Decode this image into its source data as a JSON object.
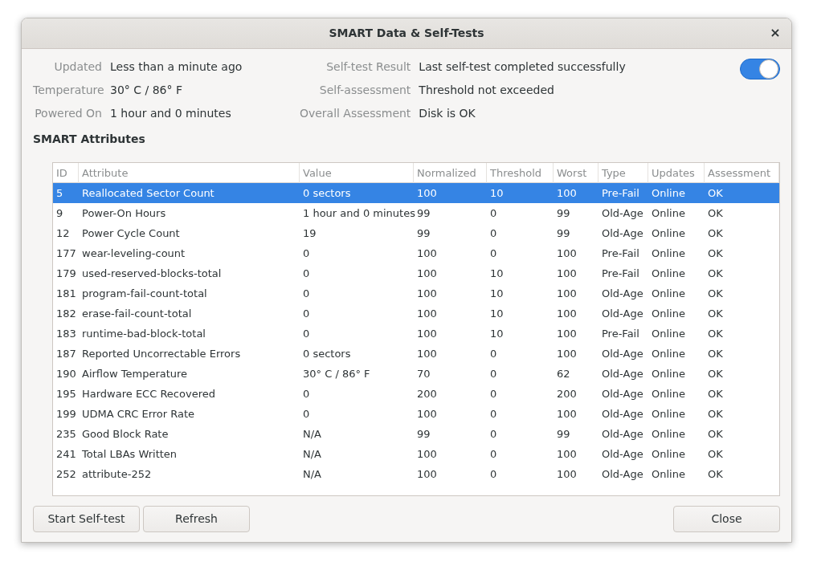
{
  "window": {
    "title": "SMART Data & Self-Tests",
    "close": "×"
  },
  "info_left": [
    {
      "label": "Updated",
      "value": "Less than a minute ago"
    },
    {
      "label": "Temperature",
      "value": "30° C / 86° F"
    },
    {
      "label": "Powered On",
      "value": "1 hour and 0 minutes"
    }
  ],
  "info_right": [
    {
      "label": "Self-test Result",
      "value": "Last self-test completed successfully"
    },
    {
      "label": "Self-assessment",
      "value": "Threshold not exceeded"
    },
    {
      "label": "Overall Assessment",
      "value": "Disk is OK"
    }
  ],
  "toggle": {
    "on": true
  },
  "section_title": "SMART Attributes",
  "table": {
    "columns": [
      "ID",
      "Attribute",
      "Value",
      "Normalized",
      "Threshold",
      "Worst",
      "Type",
      "Updates",
      "Assessment"
    ],
    "rows": [
      {
        "cells": [
          "5",
          "Reallocated Sector Count",
          "0 sectors",
          "100",
          "10",
          "100",
          "Pre-Fail",
          "Online",
          "OK"
        ],
        "selected": true
      },
      {
        "cells": [
          "9",
          "Power-On Hours",
          "1 hour and 0 minutes",
          "99",
          "0",
          "99",
          "Old-Age",
          "Online",
          "OK"
        ],
        "selected": false
      },
      {
        "cells": [
          "12",
          "Power Cycle Count",
          "19",
          "99",
          "0",
          "99",
          "Old-Age",
          "Online",
          "OK"
        ],
        "selected": false
      },
      {
        "cells": [
          "177",
          "wear-leveling-count",
          "0",
          "100",
          "0",
          "100",
          "Pre-Fail",
          "Online",
          "OK"
        ],
        "selected": false
      },
      {
        "cells": [
          "179",
          "used-reserved-blocks-total",
          "0",
          "100",
          "10",
          "100",
          "Pre-Fail",
          "Online",
          "OK"
        ],
        "selected": false
      },
      {
        "cells": [
          "181",
          "program-fail-count-total",
          "0",
          "100",
          "10",
          "100",
          "Old-Age",
          "Online",
          "OK"
        ],
        "selected": false
      },
      {
        "cells": [
          "182",
          "erase-fail-count-total",
          "0",
          "100",
          "10",
          "100",
          "Old-Age",
          "Online",
          "OK"
        ],
        "selected": false
      },
      {
        "cells": [
          "183",
          "runtime-bad-block-total",
          "0",
          "100",
          "10",
          "100",
          "Pre-Fail",
          "Online",
          "OK"
        ],
        "selected": false
      },
      {
        "cells": [
          "187",
          "Reported Uncorrectable Errors",
          "0 sectors",
          "100",
          "0",
          "100",
          "Old-Age",
          "Online",
          "OK"
        ],
        "selected": false
      },
      {
        "cells": [
          "190",
          "Airflow Temperature",
          "30° C / 86° F",
          "70",
          "0",
          "62",
          "Old-Age",
          "Online",
          "OK"
        ],
        "selected": false
      },
      {
        "cells": [
          "195",
          "Hardware ECC Recovered",
          "0",
          "200",
          "0",
          "200",
          "Old-Age",
          "Online",
          "OK"
        ],
        "selected": false
      },
      {
        "cells": [
          "199",
          "UDMA CRC Error Rate",
          "0",
          "100",
          "0",
          "100",
          "Old-Age",
          "Online",
          "OK"
        ],
        "selected": false
      },
      {
        "cells": [
          "235",
          "Good Block Rate",
          "N/A",
          "99",
          "0",
          "99",
          "Old-Age",
          "Online",
          "OK"
        ],
        "selected": false
      },
      {
        "cells": [
          "241",
          "Total LBAs Written",
          "N/A",
          "100",
          "0",
          "100",
          "Old-Age",
          "Online",
          "OK"
        ],
        "selected": false
      },
      {
        "cells": [
          "252",
          "attribute-252",
          "N/A",
          "100",
          "0",
          "100",
          "Old-Age",
          "Online",
          "OK"
        ],
        "selected": false
      }
    ]
  },
  "buttons_left": [
    "Start Self-test",
    "Refresh"
  ],
  "buttons_right": [
    "Close"
  ]
}
